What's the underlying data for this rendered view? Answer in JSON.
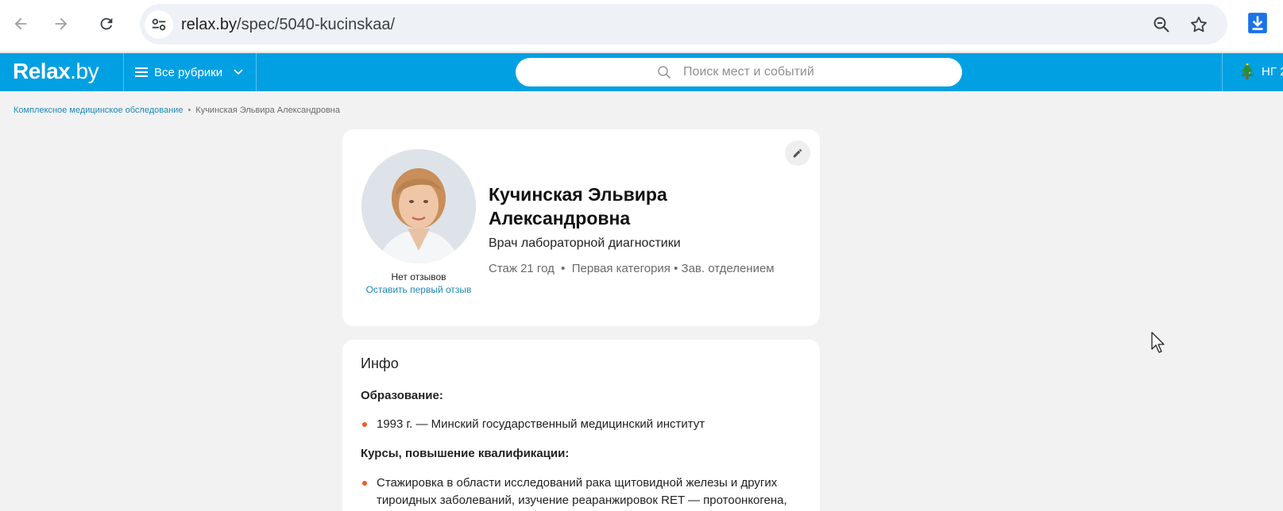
{
  "browser": {
    "url_host": "relax.by",
    "url_path": "/spec/5040-kucinskaa/"
  },
  "header": {
    "logo_main": "Relax",
    "logo_suffix": ".by",
    "rubrics_label": "Все рубрики",
    "search_placeholder": "Поиск мест и событий",
    "ng_label": "НГ 2",
    "brand_color": "#00a0e3"
  },
  "breadcrumb": {
    "parent": "Комплексное медицинское обследование",
    "separator": "•",
    "current": "Кучинская Эльвира Александровна"
  },
  "profile": {
    "name": "Кучинская Эльвира Александровна",
    "specialty": "Врач лабораторной диагностики",
    "meta": "Стаж 21 год  •  Первая категория • Зав. отделением",
    "no_reviews": "Нет отзывов",
    "leave_review": "Оставить первый отзыв"
  },
  "info": {
    "title": "Инфо",
    "education_label": "Образование:",
    "education_items": [
      "1993 г. — Минский государственный медицинский институт"
    ],
    "courses_label": "Курсы, повышение квалификации:",
    "courses_items": [
      "Стажировка в области исследований рака щитовидной железы и других тироидных заболеваний, изучение реаранжировок RET — протоонкогена,"
    ]
  },
  "accent_color": "#ef5a28"
}
